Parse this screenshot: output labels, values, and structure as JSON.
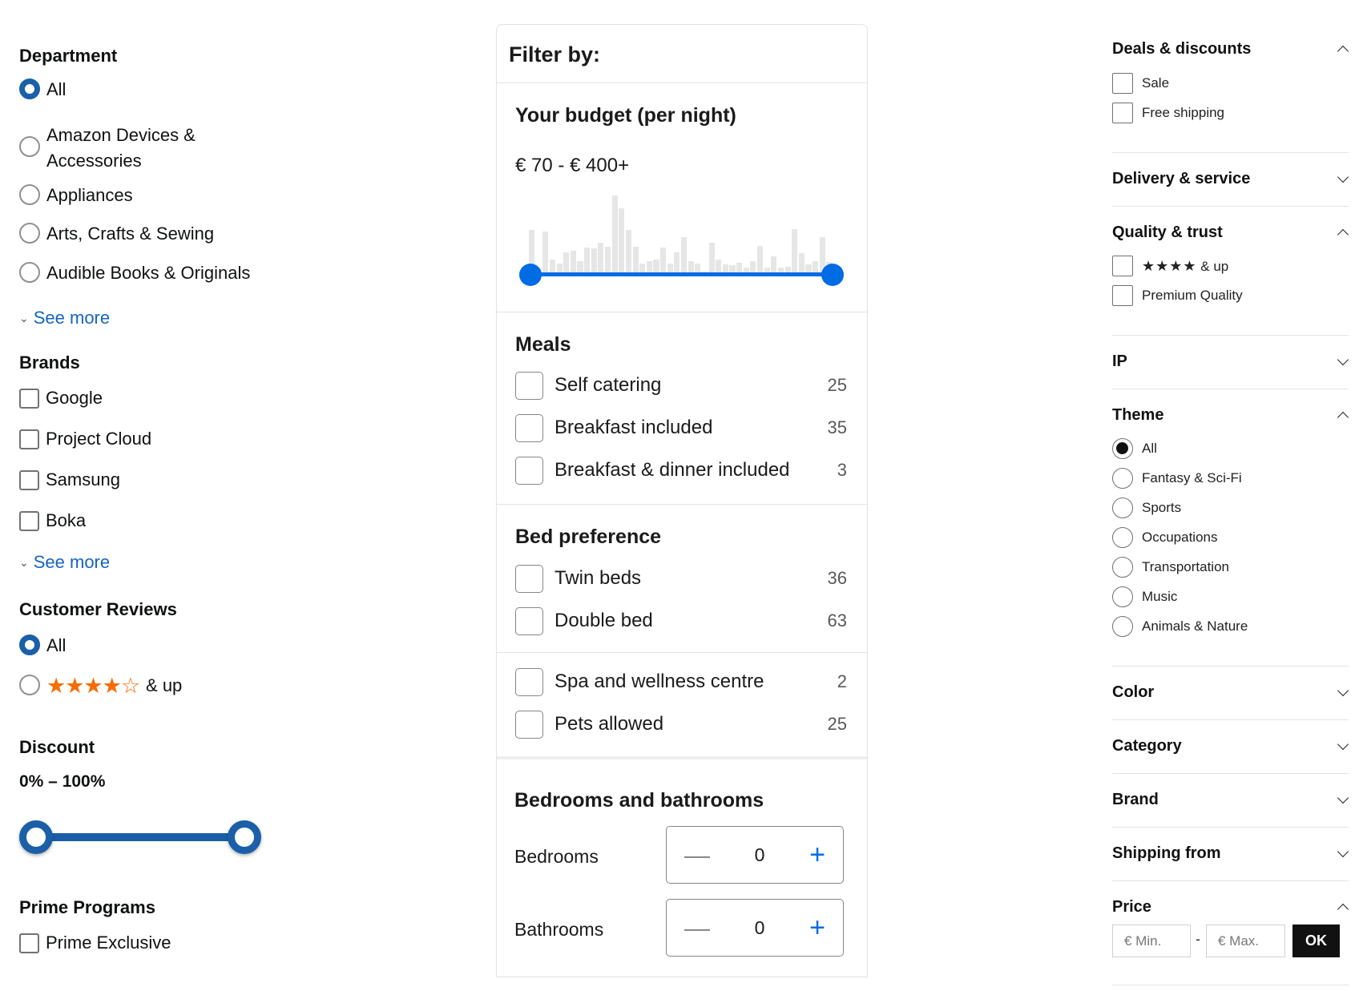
{
  "left": {
    "department": {
      "title": "Department",
      "options": [
        "All",
        "Amazon Devices &",
        "Accessories",
        "Appliances",
        "Arts, Crafts & Sewing",
        "Audible Books & Originals"
      ],
      "see_more": "See more"
    },
    "brands": {
      "title": "Brands",
      "options": [
        "Google",
        "Project Cloud",
        "Samsung",
        "Boka"
      ],
      "see_more": "See more"
    },
    "reviews": {
      "title": "Customer Reviews",
      "all": "All",
      "stars": "★★★★☆",
      "up": "& up"
    },
    "discount": {
      "title": "Discount",
      "range": "0% – 100%",
      "min_pct": 0,
      "max_pct": 100
    },
    "prime": {
      "title": "Prime Programs",
      "option": "Prime Exclusive"
    }
  },
  "middle": {
    "header": "Filter by:",
    "budget": {
      "title": "Your budget (per night)",
      "range": "€ 70 - € 400+",
      "histogram": [
        0.55,
        0.1,
        0.53,
        0.2,
        0.15,
        0.28,
        0.3,
        0.18,
        0.34,
        0.33,
        0.4,
        0.35,
        0.95,
        0.8,
        0.55,
        0.35,
        0.15,
        0.18,
        0.2,
        0.34,
        0.15,
        0.28,
        0.46,
        0.18,
        0.15,
        0.06,
        0.4,
        0.2,
        0.14,
        0.13,
        0.16,
        0.1,
        0.18,
        0.36,
        0.1,
        0.24,
        0.1,
        0.11,
        0.56,
        0.27,
        0.14,
        0.18,
        0.46,
        0.17
      ]
    },
    "meals": {
      "title": "Meals",
      "items": [
        {
          "label": "Self catering",
          "count": "25"
        },
        {
          "label": "Breakfast included",
          "count": "35"
        },
        {
          "label": "Breakfast & dinner included",
          "count": "3"
        }
      ]
    },
    "bed": {
      "title": "Bed preference",
      "items": [
        {
          "label": "Twin beds",
          "count": "36"
        },
        {
          "label": "Double bed",
          "count": "63"
        }
      ]
    },
    "facilities": {
      "items": [
        {
          "label": "Spa and wellness centre",
          "count": "2"
        },
        {
          "label": "Pets allowed",
          "count": "25"
        }
      ]
    },
    "rooms": {
      "title": "Bedrooms and bathrooms",
      "bedrooms_label": "Bedrooms",
      "bedrooms_value": "0",
      "bathrooms_label": "Bathrooms",
      "bathrooms_value": "0",
      "minus": "—",
      "plus": "+"
    }
  },
  "right": {
    "deals": {
      "title": "Deals & discounts",
      "options": [
        "Sale",
        "Free shipping"
      ]
    },
    "delivery": {
      "title": "Delivery & service"
    },
    "quality": {
      "title": "Quality & trust",
      "stars": "★★★★",
      "up": "& up",
      "premium": "Premium Quality"
    },
    "ip": {
      "title": "IP"
    },
    "theme": {
      "title": "Theme",
      "options": [
        "All",
        "Fantasy & Sci-Fi",
        "Sports",
        "Occupations",
        "Transportation",
        "Music",
        "Animals & Nature"
      ]
    },
    "color": {
      "title": "Color"
    },
    "category": {
      "title": "Category"
    },
    "brand": {
      "title": "Brand"
    },
    "shipping": {
      "title": "Shipping from"
    },
    "price": {
      "title": "Price",
      "min_placeholder": "€ Min.",
      "max_placeholder": "€ Max.",
      "dash": "-",
      "ok": "OK"
    }
  },
  "colors": {
    "amazon_blue": "#1a5fa8",
    "link_blue": "#1565c0",
    "star_orange": "#f56c00",
    "booking_blue": "#006ce4"
  }
}
